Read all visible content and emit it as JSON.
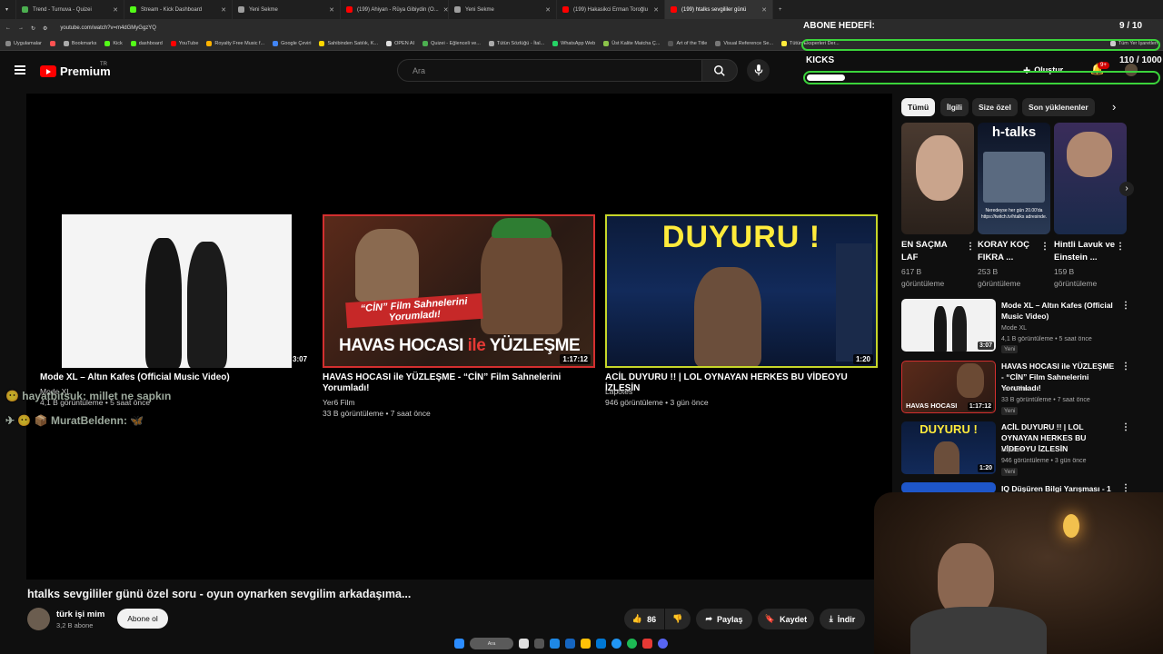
{
  "browser": {
    "tabs": [
      {
        "label": "Trend - Turnuva - Quizei",
        "color": "#4caf50"
      },
      {
        "label": "Stream - Kick Dashboard",
        "color": "#53fc18"
      },
      {
        "label": "Yeni Sekme",
        "color": "#9e9e9e"
      },
      {
        "label": "(199) Ahiyan - Rüya Gibiydin (O...",
        "color": "#ff0000"
      },
      {
        "label": "Yeni Sekme",
        "color": "#9e9e9e"
      },
      {
        "label": "(199) Hakasikci Erman Toroğlu",
        "color": "#ff0000"
      },
      {
        "label": "(199) htalks sevgililer günü",
        "color": "#ff0000"
      }
    ],
    "url": "youtube.com/watch?v=m4dGMyGgzYQ",
    "bookmarks": [
      "Uygulamalar",
      "Bookmarks",
      "Kick",
      "dashboard",
      "YouTube",
      "Royalty Free Music f...",
      "Google Çeviri",
      "Sahibinden Satılık, K...",
      "OPEN AI",
      "Quizei - Eğlenceli ve...",
      "Tütün Sözlüğü - İtal...",
      "WhatsApp Web",
      "Üst Kalite Matcha Ç...",
      "Art of the Title",
      "Visual Reference Se...",
      "Tütün Eksperleri Der...",
      "Tüm Yer İşaretleri"
    ]
  },
  "overlay": {
    "goal_title": "ABONE HEDEFİ:",
    "goal_count": "9 / 10",
    "kicks_label": "KICKS",
    "kicks_count": "110 / 1000",
    "kicks_progress": 0.11
  },
  "header": {
    "logo": "Premium",
    "region": "TR",
    "search_placeholder": "Ara",
    "create_label": "Oluştur",
    "notifications_badge": "9+"
  },
  "player": {
    "endcards": [
      {
        "title": "Mode XL – Altın Kafes (Official Music Video)",
        "channel": "Mode XL",
        "meta": "4,1 B görüntüleme • 5 saat önce",
        "duration": "3:07"
      },
      {
        "title": "HAVAS HOCASI ile YÜZLEŞME - “CİN” Film Sahnelerini Yorumladı!",
        "channel": "Yer6 Film",
        "meta": "33 B görüntüleme • 7 saat önce",
        "duration": "1:17:12"
      },
      {
        "title": "ACİL DUYURU !! | LOL OYNAYAN HERKES BU VİDEOYU İZLESİN",
        "channel": "Lapotes",
        "meta": "946 görüntüleme • 3 gün önce",
        "duration": "1:20"
      }
    ],
    "thumb_text": {
      "cin_line1": "“CİN” Film Sahnelerini",
      "cin_line2": "Yorumladı!",
      "havas_a": "HAVAS HOCASI ",
      "havas_ile": "ile",
      "havas_b": " YÜZLEŞME",
      "duyuru": "DUYURU !"
    }
  },
  "chat": [
    {
      "user": "hayatbitsuk",
      "text": "millet ne sapkın"
    },
    {
      "user": "MuratBeldenn:",
      "text": "🦋"
    }
  ],
  "video": {
    "title": "htalks sevgililer günü özel soru - oyun oynarken sevgilim arkadaşıma...",
    "channel": "türk işi mim",
    "subs": "3,2 B abone",
    "subscribe": "Abone ol",
    "likes": "86",
    "share": "Paylaş",
    "save": "Kaydet",
    "download": "İndir"
  },
  "sidebar": {
    "chips": [
      "Tümü",
      "İlgili",
      "Size özel",
      "Son yüklenenler"
    ],
    "shorts": [
      {
        "title": "EN SAÇMA LAF",
        "views": "617 B görüntüleme"
      },
      {
        "title": "KORAY KOÇ FIKRA ...",
        "views": "253 B görüntüleme"
      },
      {
        "title": "Hintli Lavuk ve Einstein ...",
        "views": "159 B görüntüleme"
      }
    ],
    "htalks_logo": "h-talks",
    "htalks_caption": "Neredeyse her gün 20.00'da https://twitch.tv/htalks adresinde.",
    "related": [
      {
        "title": "Mode XL – Altın Kafes (Official Music Video)",
        "channel": "Mode XL",
        "meta": "4,1 B görüntüleme • 5 saat önce",
        "badge": "Yeni",
        "duration": "3:07"
      },
      {
        "title": "HAVAS HOCASI ile YÜZLEŞME - “CİN” Film Sahnelerini Yorumladı!",
        "channel": "Yer6 Film",
        "meta": "33 B görüntüleme • 7 saat önce",
        "badge": "Yeni",
        "duration": "1:17:12"
      },
      {
        "title": "ACİL DUYURU !! | LOL OYNAYAN HERKES BU VİDEOYU İZLESİN",
        "channel": "Lapotes",
        "meta": "946 görüntüleme • 3 gün önce",
        "badge": "Yeni",
        "duration": "1:20"
      },
      {
        "title": "IQ Düşüren Bilgi Yarışması - 1"
      }
    ]
  },
  "taskbar": {
    "search": "Ara"
  }
}
